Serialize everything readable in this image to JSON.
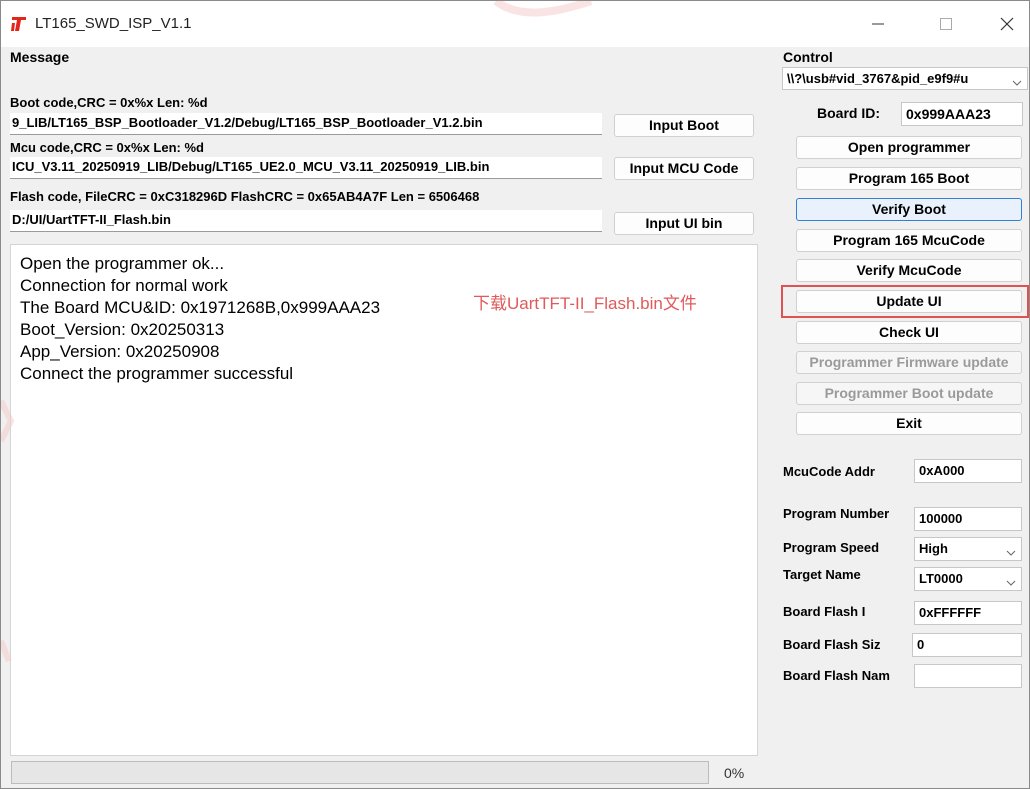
{
  "window": {
    "title": "LT165_SWD_ISP_V1.1"
  },
  "message_group": {
    "caption": "Message",
    "boot_label": "Boot code,CRC = 0x%x  Len: %d",
    "boot_path": "9_LIB/LT165_BSP_Bootloader_V1.2/Debug/LT165_BSP_Bootloader_V1.2.bin",
    "boot_button": "Input Boot",
    "mcu_label": "Mcu code,CRC = 0x%x  Len: %d",
    "mcu_path": "ICU_V3.11_20250919_LIB/Debug/LT165_UE2.0_MCU_V3.11_20250919_LIB.bin",
    "mcu_button": "Input MCU Code",
    "flash_label": "Flash code, FileCRC = 0xC318296D  FlashCRC = 0x65AB4A7F  Len = 6506468",
    "flash_path": "D:/UI/UartTFT-II_Flash.bin",
    "flash_button": "Input UI bin"
  },
  "log": {
    "lines": [
      "Open the programmer ok...",
      "Connection for normal work",
      "The Board MCU&ID: 0x1971268B,0x999AAA23",
      "Boot_Version: 0x20250313",
      "App_Version:  0x20250908",
      "Connect the programmer successful"
    ],
    "annotation": "下载UartTFT-II_Flash.bin文件"
  },
  "progress": {
    "value": 0,
    "label": "0%"
  },
  "control": {
    "caption": "Control",
    "device_select": "\\\\?\\usb#vid_3767&pid_e9f9#u",
    "board_id_label": "Board ID:",
    "board_id_value": "0x999AAA23",
    "buttons": {
      "open_programmer": "Open programmer",
      "program_boot": "Program 165 Boot",
      "verify_boot": "Verify Boot",
      "program_mcucode": "Program 165 McuCode",
      "verify_mcucode": "Verify McuCode",
      "update_ui": "Update UI",
      "check_ui": "Check UI",
      "programmer_fw_update": "Programmer Firmware update",
      "programmer_boot_update": "Programmer Boot update",
      "exit": "Exit"
    },
    "settings": {
      "mcucode_addr_label": "McuCode Addr",
      "mcucode_addr_value": "0xA000",
      "program_number_label": "Program Number",
      "program_number_value": "100000",
      "program_speed_label": "Program Speed",
      "program_speed_value": "High",
      "target_name_label": "Target Name",
      "target_name_value": "LT0000",
      "board_flash_label": "Board Flash I",
      "board_flash_value": "0xFFFFFF",
      "board_flash_size_label": "Board Flash Siz",
      "board_flash_size_value": "0",
      "board_flash_name_label": "Board Flash Nam",
      "board_flash_name_value": ""
    }
  },
  "colors": {
    "annotation": "#e05a5a",
    "highlight_box": "#e05252",
    "focus_border": "#2f7fd6",
    "logo_red": "#e2261c"
  },
  "icons": {
    "app": "lt-logo-icon",
    "minimize": "minimize-icon",
    "maximize": "maximize-icon",
    "close": "close-icon",
    "dropdown": "chevron-down-icon"
  }
}
